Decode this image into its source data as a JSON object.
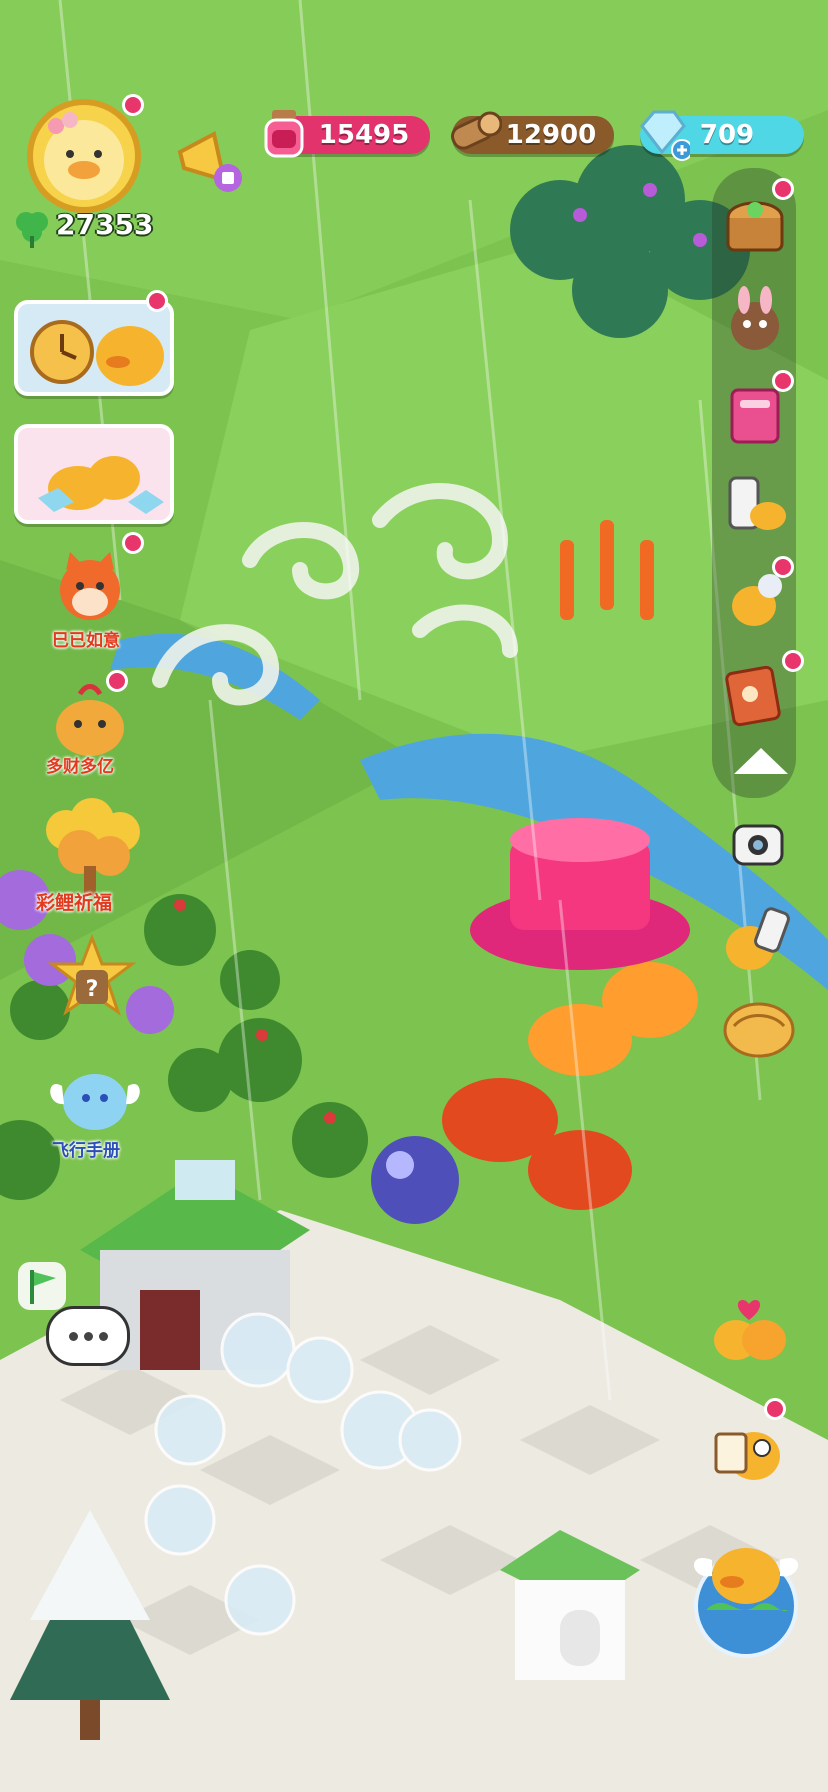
{
  "hud": {
    "resources": [
      {
        "icon": "potion-jar-icon",
        "value": "15495",
        "color": "#e2336c"
      },
      {
        "icon": "wood-log-icon",
        "value": "12900",
        "color": "#8a5a2b"
      },
      {
        "icon": "crystal-plus-icon",
        "value": "709",
        "color": "#4fd7e6"
      }
    ],
    "clover_count": "27353",
    "profile": {
      "avatar": "duck-avatar-icon"
    },
    "announcement": {
      "icon": "megaphone-icon"
    }
  },
  "left_events": [
    {
      "name": "stopwatch-duck-event",
      "label": ""
    },
    {
      "name": "gift-duck-event",
      "label": ""
    },
    {
      "name": "fox-event",
      "label": "巳已如意"
    },
    {
      "name": "lucky-bag-event",
      "label": "多财多亿"
    },
    {
      "name": "fish-tree-event",
      "label": "彩鲤祈福"
    },
    {
      "name": "mystery-box-event",
      "label": ""
    },
    {
      "name": "flight-handbook-event",
      "label": "飞行手册"
    }
  ],
  "right_rail": [
    {
      "name": "treasure-chest-icon"
    },
    {
      "name": "bunny-mask-icon"
    },
    {
      "name": "pink-book-icon"
    },
    {
      "name": "phone-duck-icon"
    },
    {
      "name": "duck-ghost-icon"
    },
    {
      "name": "recipe-book-icon"
    },
    {
      "name": "collapse-arrow-icon"
    }
  ],
  "right_buttons": [
    {
      "name": "camera-icon"
    },
    {
      "name": "duck-phone-icon"
    },
    {
      "name": "croissant-bag-icon"
    },
    {
      "name": "duck-love-icon"
    },
    {
      "name": "duck-note-icon"
    }
  ],
  "bottom": {
    "chat": {
      "icon": "chat-bubble-icon"
    },
    "flag": {
      "icon": "green-flag-icon"
    },
    "world_globe": {
      "icon": "flying-duck-globe-icon"
    }
  },
  "colors": {
    "grass": "#79c24f",
    "path": "#eeece4",
    "river": "#4fa6df",
    "alert": "#e8356b"
  }
}
